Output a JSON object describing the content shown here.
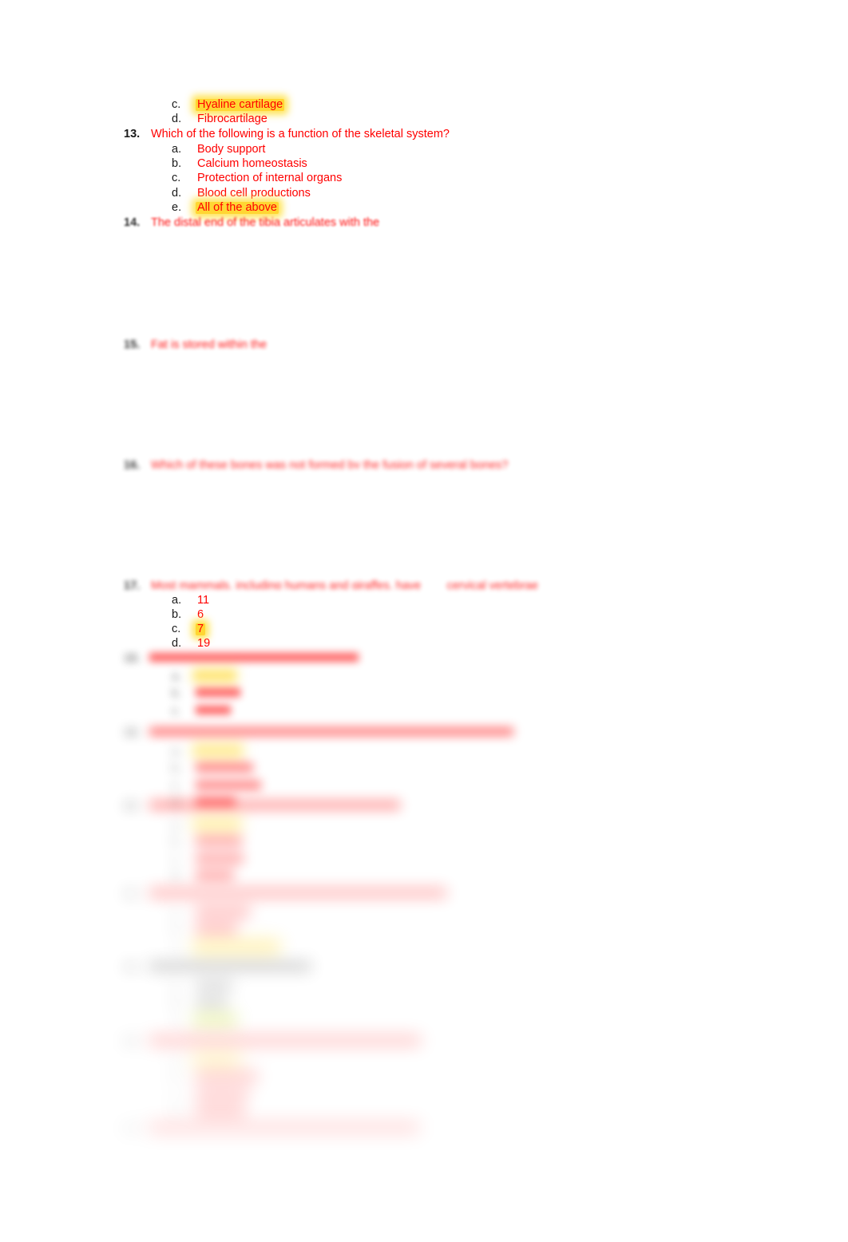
{
  "document": {
    "type": "multiple-choice-quiz",
    "subject": "Skeletal System / Anatomy",
    "text_color": "#ff0000",
    "marker_color": "#1a1a1a",
    "highlight_yellow": "#ffd633",
    "highlight_green": "#c8dc32",
    "background": "#ffffff"
  },
  "questions": [
    {
      "number": "",
      "text": "",
      "continued_options": [
        {
          "marker": "c.",
          "text": "Hyaline cartilage",
          "highlight": "yellow"
        },
        {
          "marker": "d.",
          "text": "Fibrocartilage",
          "highlight": "none"
        }
      ]
    },
    {
      "number": "13.",
      "text": "Which of the following is a function of the skeletal system?",
      "options": [
        {
          "marker": "a.",
          "text": "Body support",
          "highlight": "none"
        },
        {
          "marker": "b.",
          "text": "Calcium homeostasis",
          "highlight": "none"
        },
        {
          "marker": "c.",
          "text": "Protection of internal organs",
          "highlight": "none"
        },
        {
          "marker": "d.",
          "text": "Blood cell productions",
          "highlight": "none"
        },
        {
          "marker": "e.",
          "text": "All of the above",
          "highlight": "yellow"
        }
      ]
    },
    {
      "number": "14.",
      "text": "The distal end of the tibia articulates with the",
      "options": []
    },
    {
      "number": "15.",
      "text": "Fat is stored within the",
      "options": []
    },
    {
      "number": "16.",
      "text": "Which of these bones was not formed by the fusion of several bones?",
      "options": []
    },
    {
      "number": "17.",
      "text": "Most mammals, including humans and giraffes, have ___ cervical vertebrae",
      "options": [
        {
          "marker": "a.",
          "text": "11",
          "highlight": "none"
        },
        {
          "marker": "b.",
          "text": "6",
          "highlight": "none"
        },
        {
          "marker": "c.",
          "text": "7",
          "highlight": "yellow"
        },
        {
          "marker": "d.",
          "text": "19",
          "highlight": "none"
        }
      ]
    },
    {
      "number": "18.",
      "text": "",
      "options": [
        {
          "marker": "a.",
          "text": "",
          "highlight": "yellow"
        },
        {
          "marker": "b.",
          "text": "",
          "highlight": "none"
        },
        {
          "marker": "c.",
          "text": "",
          "highlight": "none"
        }
      ]
    },
    {
      "number": "19.",
      "text": "",
      "options": [
        {
          "marker": "a.",
          "text": "",
          "highlight": "yellow"
        },
        {
          "marker": "b.",
          "text": "",
          "highlight": "none"
        },
        {
          "marker": "c.",
          "text": "",
          "highlight": "none"
        },
        {
          "marker": "d.",
          "text": "",
          "highlight": "none"
        }
      ]
    },
    {
      "number": "20.",
      "text": "",
      "options": [
        {
          "marker": "a.",
          "text": "",
          "highlight": "yellow"
        },
        {
          "marker": "b.",
          "text": "",
          "highlight": "none"
        },
        {
          "marker": "c.",
          "text": "",
          "highlight": "none"
        },
        {
          "marker": "d.",
          "text": "",
          "highlight": "none"
        }
      ]
    },
    {
      "number": "21.",
      "text": "",
      "options": [
        {
          "marker": "a.",
          "text": "",
          "highlight": "none"
        },
        {
          "marker": "b.",
          "text": "",
          "highlight": "none"
        },
        {
          "marker": "c.",
          "text": "",
          "highlight": "yellow-wide"
        }
      ]
    },
    {
      "number": "22.",
      "text": "",
      "style": "dark",
      "options": [
        {
          "marker": "a.",
          "text": "",
          "highlight": "none"
        },
        {
          "marker": "b.",
          "text": "",
          "highlight": "none"
        },
        {
          "marker": "c.",
          "text": "",
          "highlight": "green"
        }
      ]
    },
    {
      "number": "23.",
      "text": "",
      "options": [
        {
          "marker": "a.",
          "text": "",
          "highlight": "yellow"
        },
        {
          "marker": "b.",
          "text": "",
          "highlight": "none"
        },
        {
          "marker": "c.",
          "text": "",
          "highlight": "none"
        },
        {
          "marker": "d.",
          "text": "",
          "highlight": "none"
        }
      ]
    },
    {
      "number": "24.",
      "text": "",
      "options": []
    }
  ]
}
